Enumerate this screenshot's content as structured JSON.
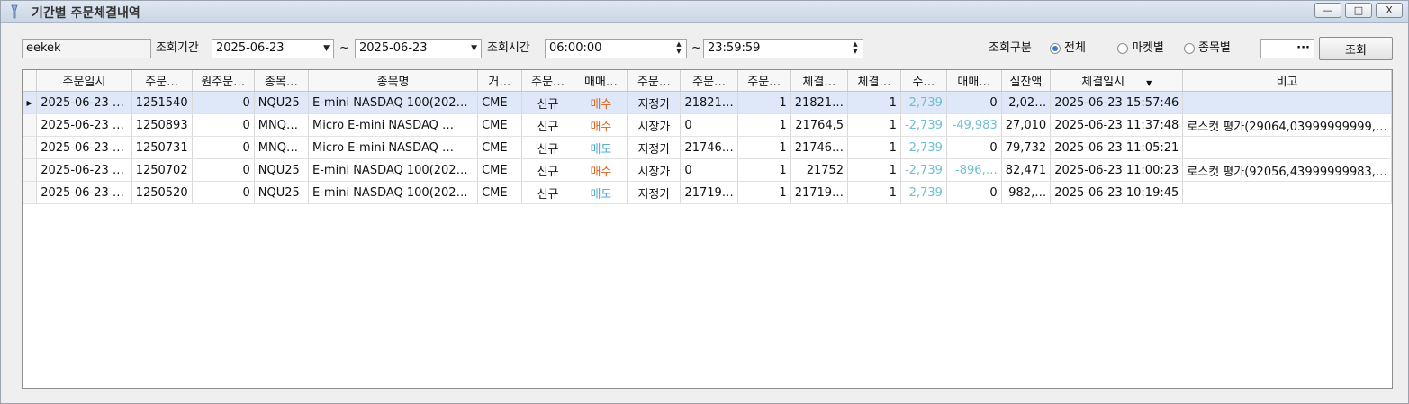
{
  "window": {
    "title": "기간별 주문체결내역",
    "min_label": "—",
    "max_label": "□",
    "close_label": "X"
  },
  "filter": {
    "account": "eekek",
    "period_label": "조회기간",
    "date_from": "2025-06-23",
    "tilde1": "~",
    "date_to": "2025-06-23",
    "time_label": "조회시간",
    "time_from": "06:00:00",
    "tilde2": "~",
    "time_to": "23:59:59",
    "type_label": "조회구분",
    "radio_all": "전체",
    "radio_market": "마켓별",
    "radio_item": "종목별",
    "browse_label": "···",
    "search_label": "조회"
  },
  "table": {
    "columns": [
      "주문일시",
      "주문…",
      "원주문…",
      "종목…",
      "종목명",
      "거…",
      "주문…",
      "매매…",
      "주문…",
      "주문…",
      "주문…",
      "체결…",
      "체결…",
      "수…",
      "매매…",
      "실잔액",
      "체결일시",
      "비고"
    ],
    "rows": [
      [
        "2025-06-23 …",
        "1251540",
        "0",
        "NQU25",
        "E-mini NASDAQ 100(202…",
        "CME",
        "신규",
        "매수",
        "지정가",
        "21821…",
        "1",
        "21821…",
        "1",
        "-2,739",
        "0",
        "2,02…",
        "2025-06-23 15:57:46",
        ""
      ],
      [
        "2025-06-23 …",
        "1250893",
        "0",
        "MNQ…",
        "Micro E-mini NASDAQ …",
        "CME",
        "신규",
        "매수",
        "시장가",
        "0",
        "1",
        "21764,5",
        "1",
        "-2,739",
        "-49,983",
        "27,010",
        "2025-06-23 11:37:48",
        "로스컷 평가(29064,03999999999,…"
      ],
      [
        "2025-06-23 …",
        "1250731",
        "0",
        "MNQ…",
        "Micro E-mini NASDAQ …",
        "CME",
        "신규",
        "매도",
        "지정가",
        "21746…",
        "1",
        "21746…",
        "1",
        "-2,739",
        "0",
        "79,732",
        "2025-06-23 11:05:21",
        ""
      ],
      [
        "2025-06-23 …",
        "1250702",
        "0",
        "NQU25",
        "E-mini NASDAQ 100(202…",
        "CME",
        "신규",
        "매수",
        "시장가",
        "0",
        "1",
        "21752",
        "1",
        "-2,739",
        "-896,…",
        "82,471",
        "2025-06-23 11:00:23",
        "로스컷 평가(92056,43999999983,…"
      ],
      [
        "2025-06-23 …",
        "1250520",
        "0",
        "NQU25",
        "E-mini NASDAQ 100(202…",
        "CME",
        "신규",
        "매도",
        "지정가",
        "21719…",
        "1",
        "21719…",
        "1",
        "-2,739",
        "0",
        "982,…",
        "2025-06-23 10:19:45",
        ""
      ]
    ]
  },
  "colors": {
    "buy": "#d9641c",
    "sell": "#4aa8d2",
    "negative": "#6fbfd0",
    "selected_row": "#dfe8f8"
  }
}
